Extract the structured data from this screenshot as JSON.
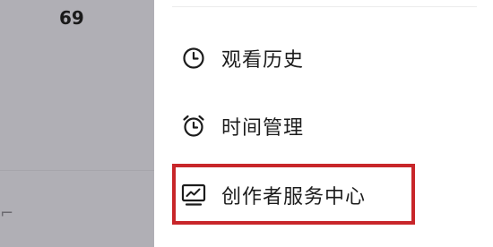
{
  "left_panel": {
    "stat_value": "69"
  },
  "menu": {
    "items": [
      {
        "label": "观看历史",
        "icon": "clock-icon"
      },
      {
        "label": "时间管理",
        "icon": "alarm-clock-icon"
      },
      {
        "label": "创作者服务中心",
        "icon": "creator-chart-icon"
      }
    ]
  },
  "highlight": {
    "target": "创作者服务中心",
    "color": "#c8262a"
  },
  "colors": {
    "overlay_background": "#b0afb5",
    "drawer_background": "#ffffff",
    "text": "#1c1c1c"
  }
}
